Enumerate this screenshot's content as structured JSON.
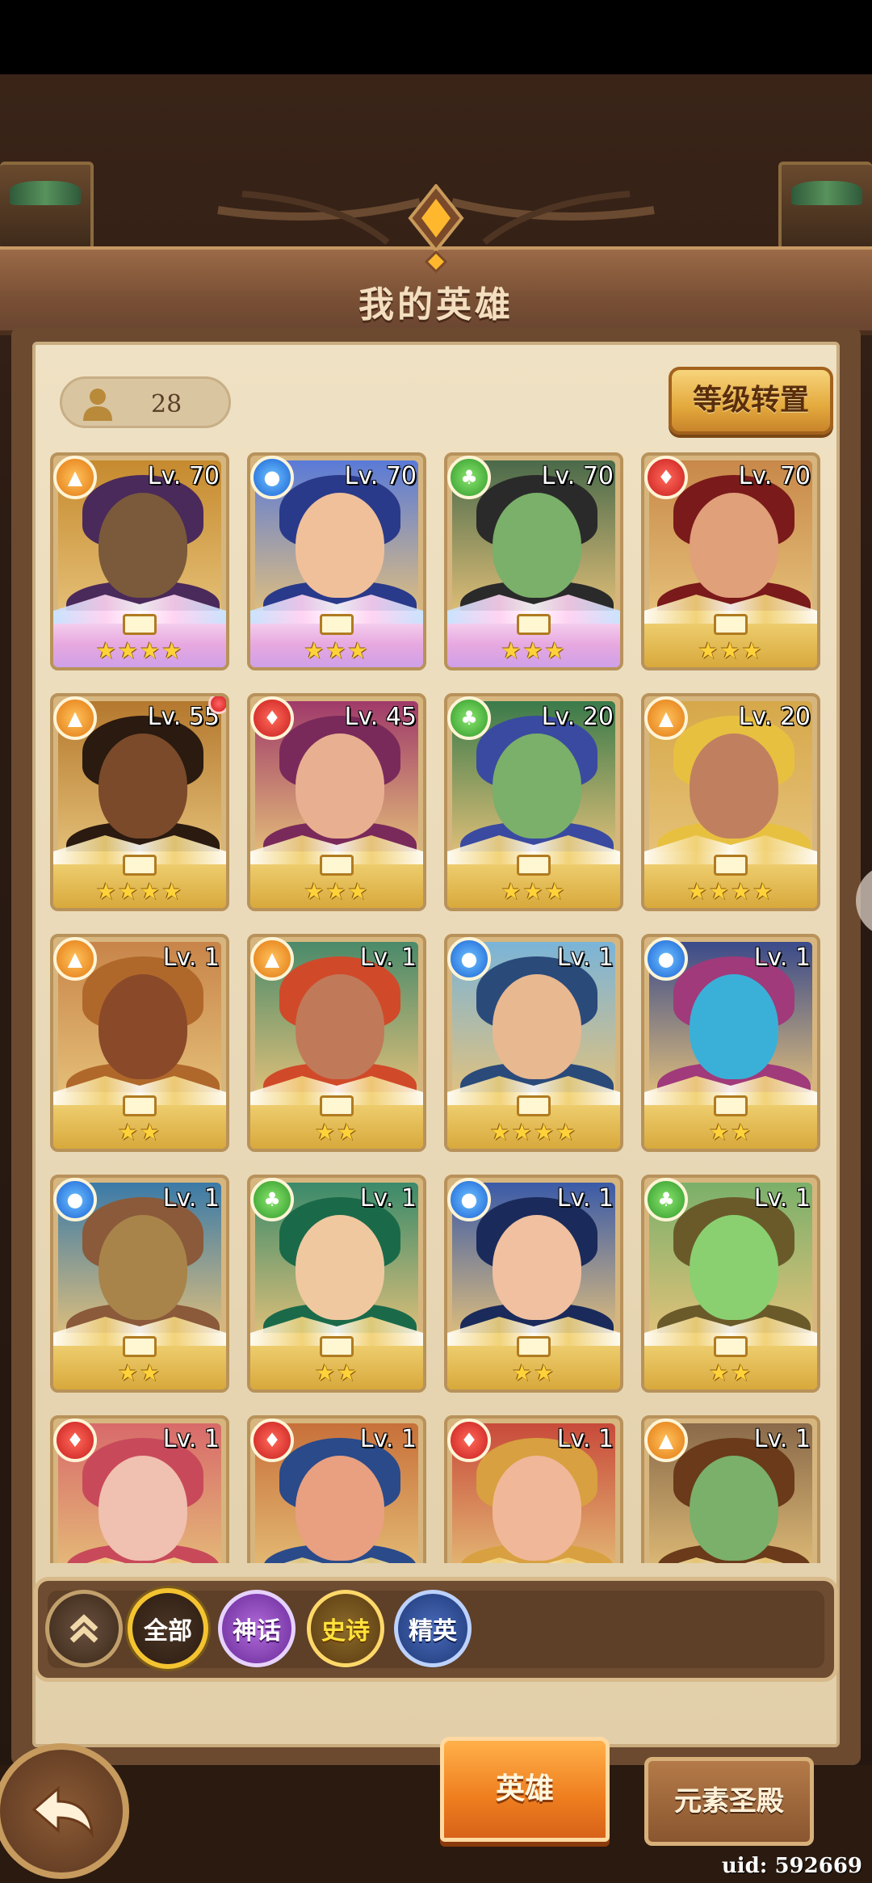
{
  "header": {
    "title": "我的英雄"
  },
  "hero_count": "28",
  "buttons": {
    "level_transfer": "等级转置"
  },
  "heroes": [
    {
      "level": "Lv. 70",
      "element": "light",
      "stars": "★★★★",
      "rarity": "mythic",
      "colors": [
        "#c68a2e",
        "#7a5a3a",
        "#4a2a5a"
      ]
    },
    {
      "level": "Lv. 70",
      "element": "water",
      "stars": "★★★",
      "rarity": "mythic",
      "colors": [
        "#5a7ad8",
        "#f0c09a",
        "#2a3a8a"
      ]
    },
    {
      "level": "Lv. 70",
      "element": "nature",
      "stars": "★★★",
      "rarity": "mythic",
      "colors": [
        "#4a6a4a",
        "#7ab06a",
        "#2a2a2a"
      ]
    },
    {
      "level": "Lv. 70",
      "element": "fire",
      "stars": "★★★",
      "rarity": "epic",
      "colors": [
        "#c8884a",
        "#e0a07a",
        "#7a1a1a"
      ]
    },
    {
      "level": "Lv. 55",
      "element": "light",
      "stars": "★★★★",
      "rarity": "epic",
      "colors": [
        "#b4782e",
        "#7a4a2a",
        "#2a1a10"
      ],
      "notice": true
    },
    {
      "level": "Lv. 45",
      "element": "fire",
      "stars": "★★★",
      "rarity": "epic",
      "colors": [
        "#a03a6a",
        "#e8b090",
        "#7a2a5a"
      ]
    },
    {
      "level": "Lv. 20",
      "element": "nature",
      "stars": "★★★",
      "rarity": "epic",
      "colors": [
        "#3a7a4a",
        "#7ab06a",
        "#3a4aa0"
      ]
    },
    {
      "level": "Lv. 20",
      "element": "light",
      "stars": "★★★★",
      "rarity": "epic",
      "colors": [
        "#d6a84a",
        "#c08060",
        "#e8c040"
      ]
    },
    {
      "level": "Lv. 1",
      "element": "light",
      "stars": "★★",
      "rarity": "epic",
      "colors": [
        "#c8844a",
        "#8a4a2a",
        "#b0682a"
      ]
    },
    {
      "level": "Lv. 1",
      "element": "light",
      "stars": "★★",
      "rarity": "epic",
      "colors": [
        "#4a8a6a",
        "#c07a5a",
        "#d04a2a"
      ]
    },
    {
      "level": "Lv. 1",
      "element": "water",
      "stars": "★★★★",
      "rarity": "epic",
      "colors": [
        "#7ab4d8",
        "#e8b890",
        "#2a4a7a"
      ]
    },
    {
      "level": "Lv. 1",
      "element": "water",
      "stars": "★★",
      "rarity": "epic",
      "colors": [
        "#3a4a8a",
        "#3ab0d8",
        "#a03a7a"
      ]
    },
    {
      "level": "Lv. 1",
      "element": "water",
      "stars": "★★",
      "rarity": "epic",
      "colors": [
        "#3a7aa8",
        "#a8844a",
        "#8a5a3a"
      ]
    },
    {
      "level": "Lv. 1",
      "element": "nature",
      "stars": "★★",
      "rarity": "epic",
      "colors": [
        "#3a8a6a",
        "#f0c8a0",
        "#1a6a4a"
      ]
    },
    {
      "level": "Lv. 1",
      "element": "water",
      "stars": "★★",
      "rarity": "epic",
      "colors": [
        "#3a5aa8",
        "#f0c0a0",
        "#1a2a5a"
      ]
    },
    {
      "level": "Lv. 1",
      "element": "nature",
      "stars": "★★",
      "rarity": "epic",
      "colors": [
        "#7ab06a",
        "#8ad070",
        "#6a5a2a"
      ]
    },
    {
      "level": "Lv. 1",
      "element": "fire",
      "stars": "",
      "rarity": "epic",
      "colors": [
        "#d86a6a",
        "#f0c0b0",
        "#c84a5a"
      ]
    },
    {
      "level": "Lv. 1",
      "element": "fire",
      "stars": "",
      "rarity": "epic",
      "colors": [
        "#c8703a",
        "#e8a080",
        "#2a4a8a"
      ]
    },
    {
      "level": "Lv. 1",
      "element": "fire",
      "stars": "",
      "rarity": "epic",
      "colors": [
        "#c84a3a",
        "#f0b898",
        "#d8a040"
      ]
    },
    {
      "level": "Lv. 1",
      "element": "light",
      "stars": "",
      "rarity": "epic",
      "colors": [
        "#8a6a4a",
        "#7ab06a",
        "#6a3a1a"
      ]
    }
  ],
  "filters": {
    "all": "全部",
    "mythic": "神话",
    "epic": "史诗",
    "elite": "精英"
  },
  "tabs": {
    "heroes": "英雄",
    "temple": "元素圣殿"
  },
  "uid": "uid: 592669"
}
